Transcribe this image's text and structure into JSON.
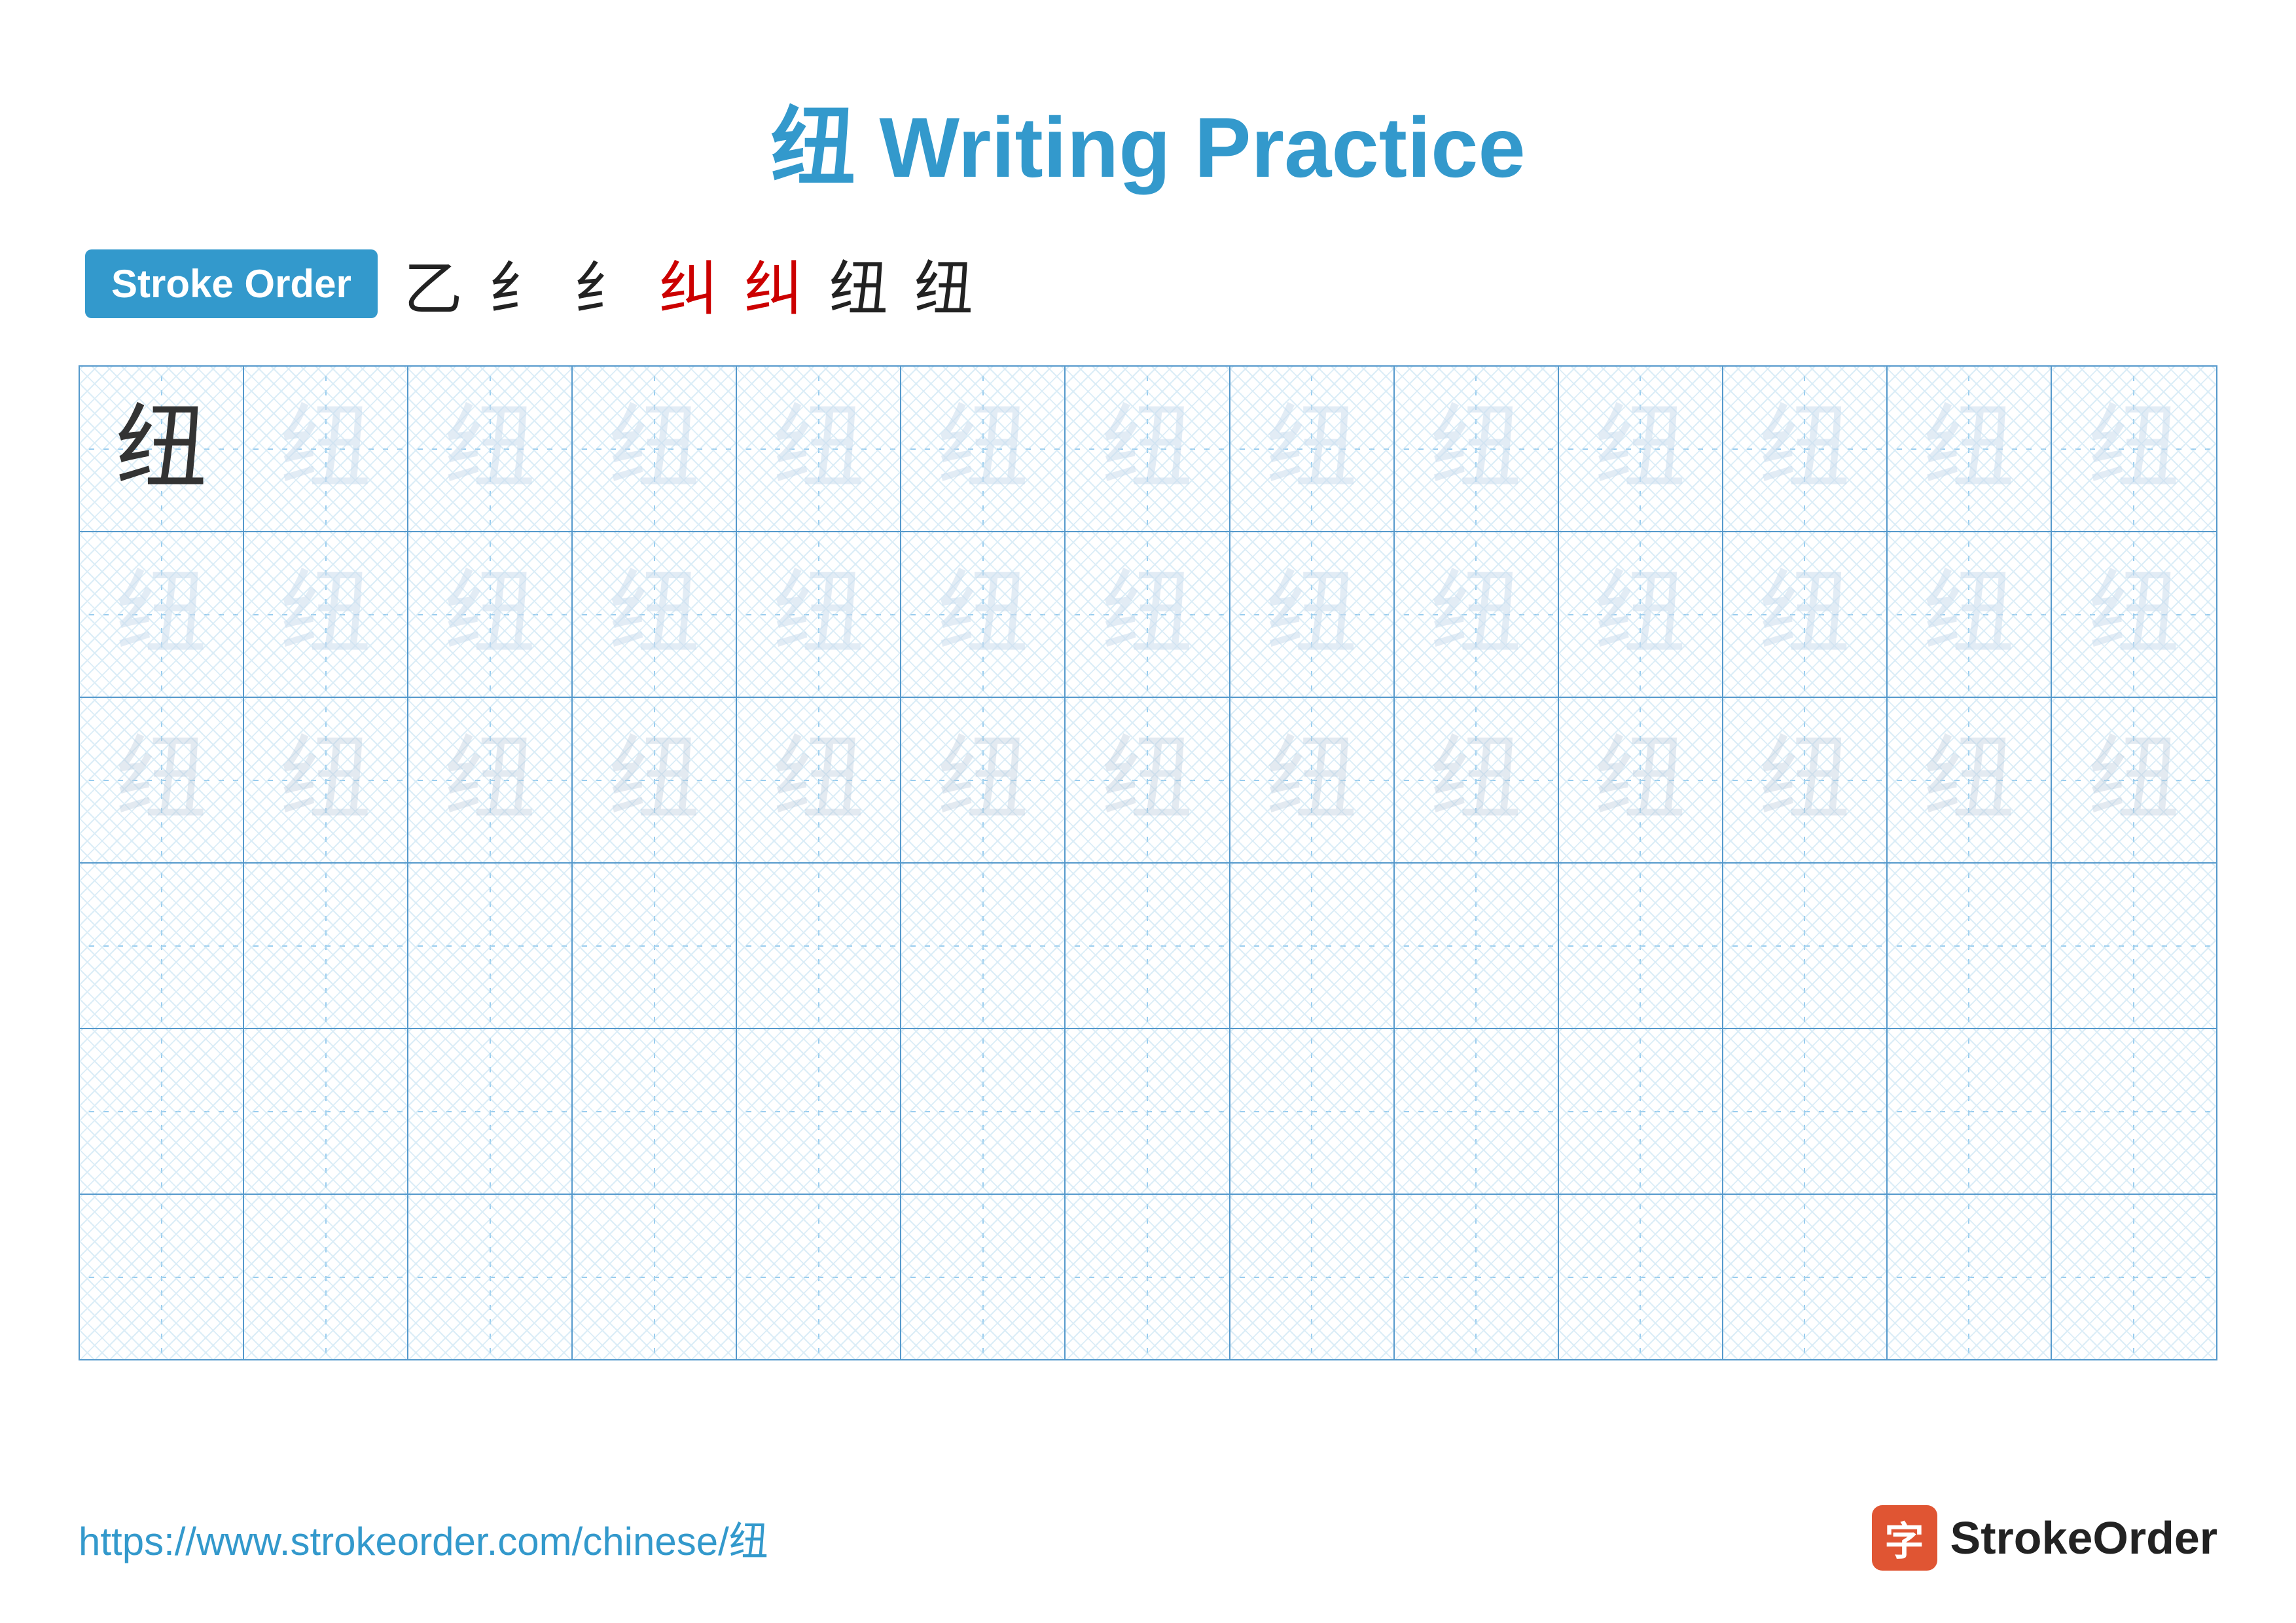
{
  "title": {
    "char": "纽",
    "label": " Writing Practice"
  },
  "stroke_order": {
    "badge_label": "Stroke Order",
    "strokes": [
      "乙",
      "纟",
      "纟",
      "纠",
      "纠",
      "纽",
      "纽"
    ]
  },
  "grid": {
    "rows": 6,
    "cols": 13,
    "char": "纽",
    "row_styles": [
      "dark-first",
      "light",
      "lighter",
      "empty",
      "empty",
      "empty"
    ]
  },
  "footer": {
    "url": "https://www.strokeorder.com/chinese/纽",
    "logo_char": "字",
    "logo_name": "StrokeOrder"
  }
}
